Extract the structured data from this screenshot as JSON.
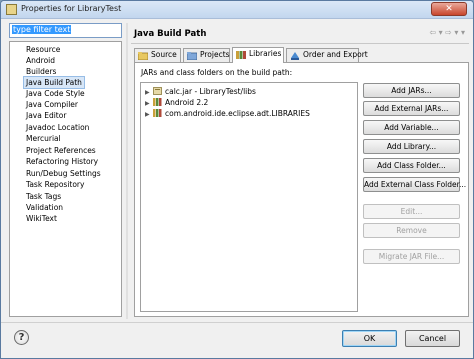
{
  "window": {
    "title": "Properties for LibraryTest",
    "close_label": "✕"
  },
  "filter": {
    "value": "type filter text"
  },
  "nav_tree": {
    "items": [
      {
        "label": "Resource",
        "selected": false
      },
      {
        "label": "Android",
        "selected": false
      },
      {
        "label": "Builders",
        "selected": false
      },
      {
        "label": "Java Build Path",
        "selected": true
      },
      {
        "label": "Java Code Style",
        "selected": false
      },
      {
        "label": "Java Compiler",
        "selected": false
      },
      {
        "label": "Java Editor",
        "selected": false
      },
      {
        "label": "Javadoc Location",
        "selected": false
      },
      {
        "label": "Mercurial",
        "selected": false
      },
      {
        "label": "Project References",
        "selected": false
      },
      {
        "label": "Refactoring History",
        "selected": false
      },
      {
        "label": "Run/Debug Settings",
        "selected": false
      },
      {
        "label": "Task Repository",
        "selected": false
      },
      {
        "label": "Task Tags",
        "selected": false
      },
      {
        "label": "Validation",
        "selected": false
      },
      {
        "label": "WikiText",
        "selected": false
      }
    ]
  },
  "page": {
    "title": "Java Build Path",
    "nav_arrows": "⇦ ▾ ⇨ ▾ ▾"
  },
  "tabs": [
    {
      "label": "Source",
      "icon": "source-folder-icon",
      "active": false
    },
    {
      "label": "Projects",
      "icon": "projects-icon",
      "active": false
    },
    {
      "label": "Libraries",
      "icon": "libraries-icon",
      "active": true
    },
    {
      "label": "Order and Export",
      "icon": "order-export-icon",
      "active": false
    }
  ],
  "libraries": {
    "heading": "JARs and class folders on the build path:",
    "entries": [
      {
        "label": "calc.jar - LibraryTest/libs",
        "icon": "jar-icon"
      },
      {
        "label": "Android 2.2",
        "icon": "library-icon"
      },
      {
        "label": "com.android.ide.eclipse.adt.LIBRARIES",
        "icon": "library-icon"
      }
    ]
  },
  "buttons": {
    "add_jars": "Add JARs...",
    "add_external_jars": "Add External JARs...",
    "add_variable": "Add Variable...",
    "add_library": "Add Library...",
    "add_class_folder": "Add Class Folder...",
    "add_external_class_folder": "Add External Class Folder...",
    "edit": "Edit...",
    "remove": "Remove",
    "migrate_jar": "Migrate JAR File..."
  },
  "dialog": {
    "help": "?",
    "ok": "OK",
    "cancel": "Cancel"
  },
  "colors": {
    "selection": "#d7e6f7",
    "accent": "#3399ff"
  }
}
